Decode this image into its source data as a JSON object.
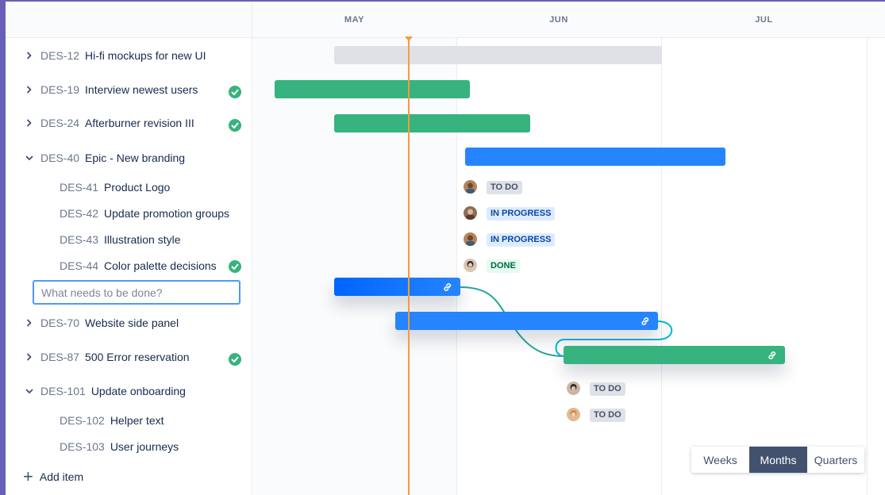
{
  "timeline": {
    "months": [
      "MAY",
      "JUN",
      "JUL"
    ]
  },
  "issues": [
    {
      "key": "DES-12",
      "title": "Hi-fi mockups for new UI",
      "expandable": true,
      "expanded": false,
      "done": false
    },
    {
      "key": "DES-19",
      "title": "Interview newest users",
      "expandable": true,
      "expanded": false,
      "done": true
    },
    {
      "key": "DES-24",
      "title": "Afterburner revision III",
      "expandable": true,
      "expanded": false,
      "done": true
    },
    {
      "key": "DES-40",
      "title": "Epic - New branding",
      "expandable": true,
      "expanded": true,
      "done": false
    },
    {
      "key": "DES-41",
      "title": "Product Logo",
      "child": true,
      "done": false
    },
    {
      "key": "DES-42",
      "title": "Update promotion groups",
      "child": true,
      "done": false
    },
    {
      "key": "DES-43",
      "title": "Illustration style",
      "child": true,
      "done": false
    },
    {
      "key": "DES-44",
      "title": "Color palette decisions",
      "child": true,
      "done": true
    },
    {
      "key": "DES-70",
      "title": "Website side panel",
      "expandable": true,
      "expanded": false,
      "done": false
    },
    {
      "key": "DES-87",
      "title": "500 Error reservation",
      "expandable": true,
      "expanded": false,
      "done": true
    },
    {
      "key": "DES-101",
      "title": "Update onboarding",
      "expandable": true,
      "expanded": true,
      "done": false
    },
    {
      "key": "DES-102",
      "title": "Helper text",
      "child": true,
      "done": false
    },
    {
      "key": "DES-103",
      "title": "User journeys",
      "child": true,
      "done": false
    }
  ],
  "new_issue": {
    "placeholder": "What needs to be done?",
    "value": ""
  },
  "add_item_label": "Add item",
  "statuses": {
    "des41": "TO DO",
    "des42": "IN PROGRESS",
    "des43": "IN PROGRESS",
    "des44": "DONE",
    "des102": "TO DO",
    "des103": "TO DO"
  },
  "view_switcher": {
    "options": [
      "Weeks",
      "Months",
      "Quarters"
    ],
    "selected": "Months"
  },
  "colors": {
    "bar_green": "#36b37e",
    "bar_blue": "#2684ff",
    "bar_gray": "#dfe1e6",
    "today_line": "#f79a3e",
    "dependency_line": "#26a69a"
  },
  "icons": {
    "expand": "chevron-right-icon",
    "collapse": "chevron-down-icon",
    "done": "check-circle-icon",
    "link": "link-icon",
    "add": "plus-icon"
  }
}
